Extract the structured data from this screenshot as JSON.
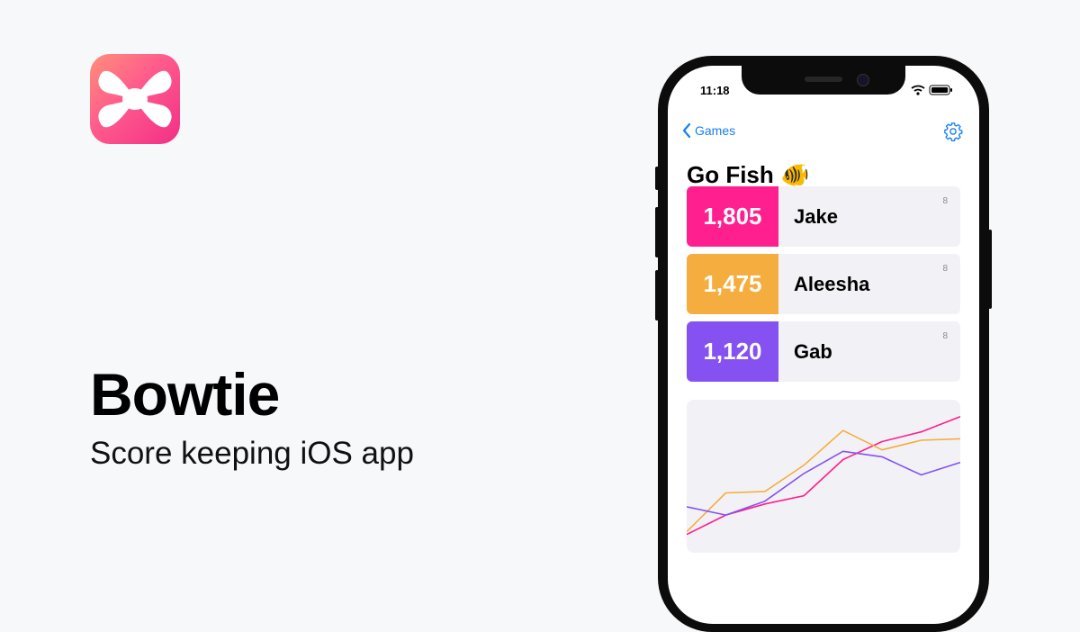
{
  "brand": {
    "name": "Bowtie",
    "tagline": "Score keeping iOS app",
    "gradient": [
      "#ff8f7a",
      "#ff5a8c",
      "#f22f86"
    ]
  },
  "status_bar": {
    "time": "11:18"
  },
  "nav": {
    "back_label": "Games"
  },
  "game": {
    "title": "Go Fish 🐠"
  },
  "players": [
    {
      "score": "1,805",
      "name": "Jake",
      "rounds": "8",
      "color": "#ff1f8e"
    },
    {
      "score": "1,475",
      "name": "Aleesha",
      "rounds": "8",
      "color": "#f5ad3f"
    },
    {
      "score": "1,120",
      "name": "Gab",
      "rounds": "8",
      "color": "#8552f1"
    }
  ],
  "chart_data": {
    "type": "line",
    "title": "",
    "xlabel": "",
    "ylabel": "",
    "x": [
      1,
      2,
      3,
      4,
      5,
      6,
      7,
      8
    ],
    "ylim": [
      0,
      100
    ],
    "grid": false,
    "series": [
      {
        "color": "#ff1f8e",
        "values": [
          8,
          22,
          30,
          36,
          62,
          75,
          82,
          93
        ]
      },
      {
        "color": "#f5ad3f",
        "values": [
          10,
          38,
          39,
          58,
          83,
          69,
          76,
          77
        ]
      },
      {
        "color": "#8552f1",
        "values": [
          28,
          22,
          32,
          52,
          68,
          64,
          51,
          60
        ]
      }
    ]
  }
}
